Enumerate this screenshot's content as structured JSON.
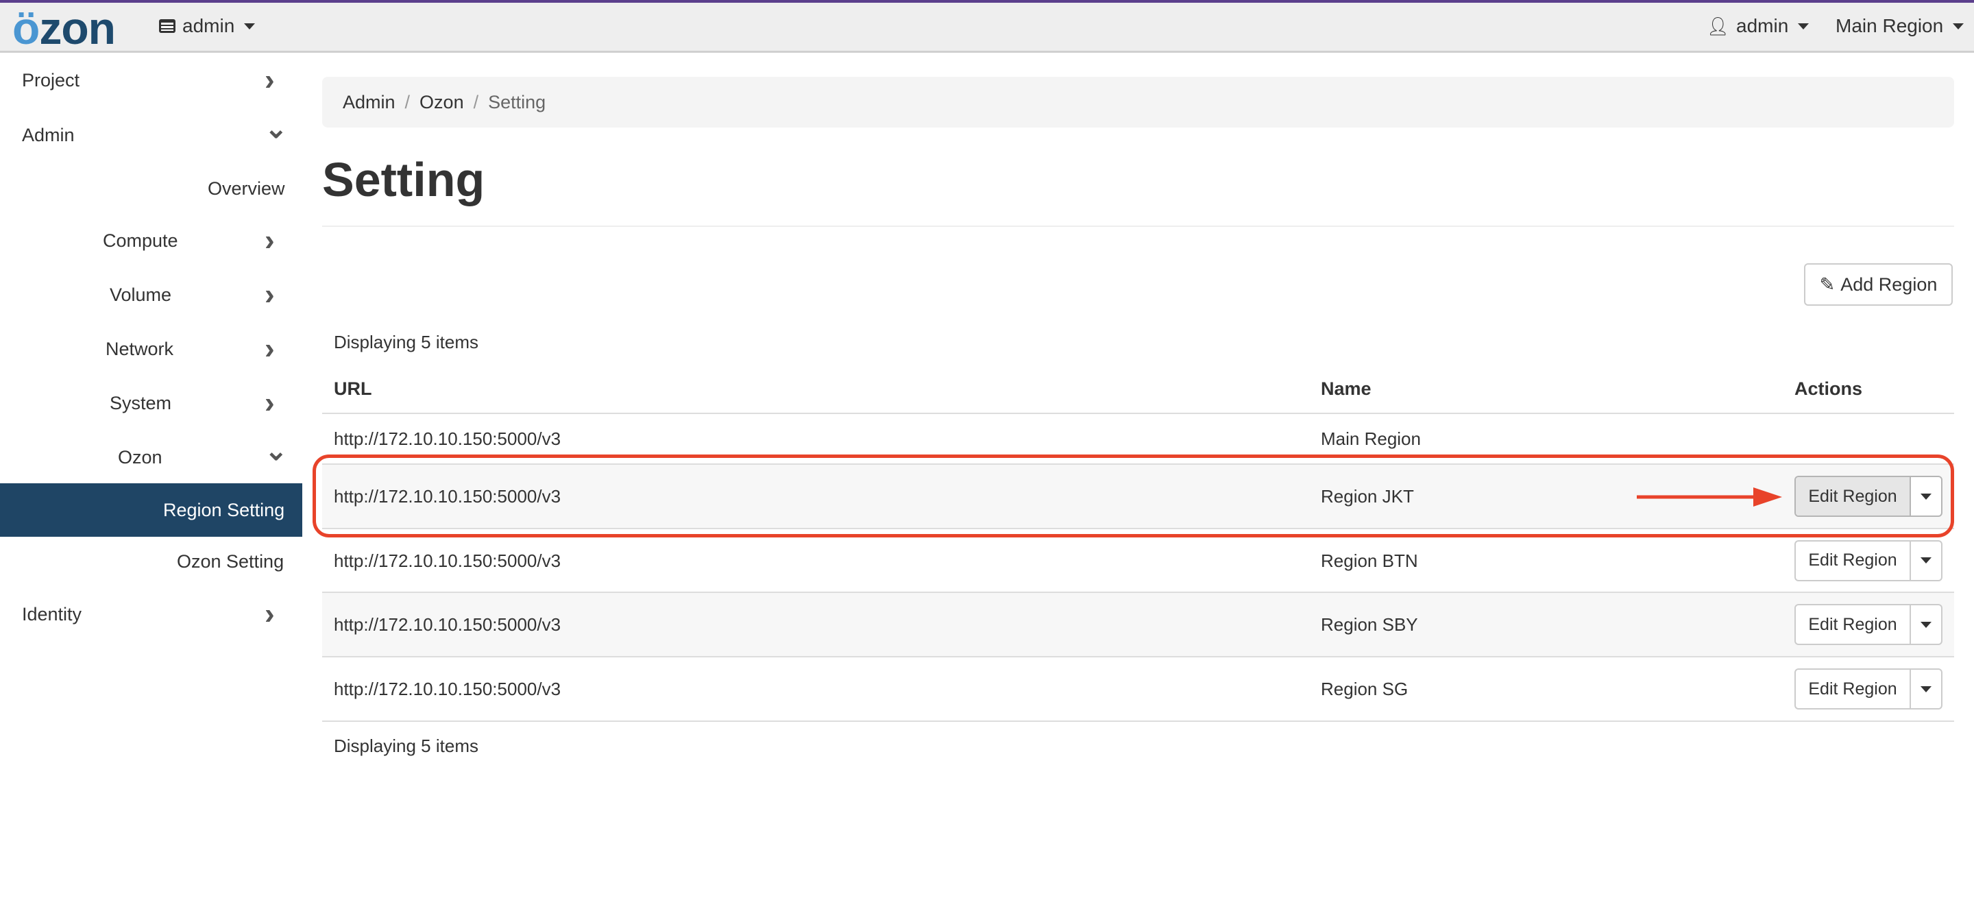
{
  "header": {
    "logo": "ozon",
    "project_menu": "admin",
    "user_menu": "admin",
    "region_menu": "Main Region"
  },
  "sidebar": {
    "items": [
      {
        "label": "Project",
        "icon": "chevron-right"
      },
      {
        "label": "Admin",
        "icon": "chevron-down"
      },
      {
        "label": "Overview"
      },
      {
        "label": "Compute",
        "icon": "chevron-right"
      },
      {
        "label": "Volume",
        "icon": "chevron-right"
      },
      {
        "label": "Network",
        "icon": "chevron-right"
      },
      {
        "label": "System",
        "icon": "chevron-right"
      },
      {
        "label": "Ozon",
        "icon": "chevron-down"
      },
      {
        "label": "Region Setting",
        "active": true
      },
      {
        "label": "Ozon Setting"
      },
      {
        "label": "Identity",
        "icon": "chevron-right"
      }
    ]
  },
  "breadcrumb": [
    "Admin",
    "Ozon",
    "Setting"
  ],
  "page": {
    "title": "Setting",
    "add_button": "Add Region",
    "displaying_top": "Displaying 5 items",
    "displaying_bottom": "Displaying 5 items"
  },
  "table": {
    "columns": [
      "URL",
      "Name",
      "Actions"
    ],
    "rows": [
      {
        "url": "http://172.10.10.150:5000/v3",
        "name": "Main Region",
        "action": ""
      },
      {
        "url": "http://172.10.10.150:5000/v3",
        "name": "Region JKT",
        "action": "Edit Region"
      },
      {
        "url": "http://172.10.10.150:5000/v3",
        "name": "Region BTN",
        "action": "Edit Region"
      },
      {
        "url": "http://172.10.10.150:5000/v3",
        "name": "Region SBY",
        "action": "Edit Region"
      },
      {
        "url": "http://172.10.10.150:5000/v3",
        "name": "Region SG",
        "action": "Edit Region"
      }
    ]
  },
  "colors": {
    "accent": "#1f4565",
    "logo_dot": "#4a96d2",
    "annotation": "#e8432a",
    "top_bar": "#5b3f8c"
  }
}
